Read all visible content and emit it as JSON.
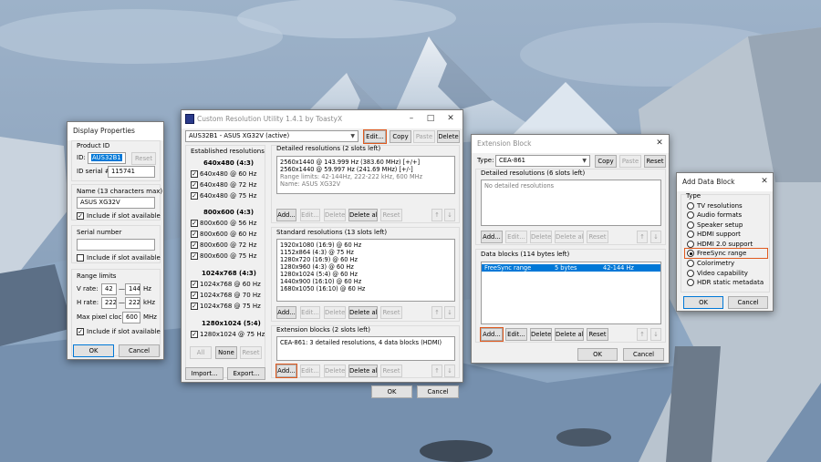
{
  "display_properties": {
    "title": "Display Properties",
    "product_id_label": "Product ID",
    "id_label": "ID:",
    "id_value": "AUS32B1",
    "reset_label": "Reset",
    "serial_label": "ID serial #:",
    "serial_value": "115741",
    "name_label": "Name (13 characters max)",
    "name_value": "ASUS XG32V",
    "include_slot_label": "Include if slot available",
    "serial_number_label": "Serial number",
    "serial_number_value": "",
    "range_limits_label": "Range limits",
    "vrate_label": "V rate:",
    "vrate_min": "42",
    "vrate_max": "144",
    "vrate_unit": "Hz",
    "hrate_label": "H rate:",
    "hrate_min": "222",
    "hrate_max": "222",
    "hrate_unit": "kHz",
    "pixclk_label": "Max pixel clock:",
    "pixclk_value": "600",
    "pixclk_unit": "MHz",
    "dash": "—",
    "ok_label": "OK",
    "cancel_label": "Cancel"
  },
  "cru": {
    "title": "Custom Resolution Utility 1.4.1 by ToastyX",
    "monitor_select": "AUS32B1 - ASUS XG32V (active)",
    "edit_label": "Edit...",
    "copy_label": "Copy",
    "paste_label": "Paste",
    "delete_label": "Delete",
    "established_label": "Established resolutions",
    "est_groups": [
      {
        "header": "640x480 (4:3)",
        "items": [
          "640x480 @ 60 Hz",
          "640x480 @ 72 Hz",
          "640x480 @ 75 Hz"
        ]
      },
      {
        "header": "800x600 (4:3)",
        "items": [
          "800x600 @ 56 Hz",
          "800x600 @ 60 Hz",
          "800x600 @ 72 Hz",
          "800x600 @ 75 Hz"
        ]
      },
      {
        "header": "1024x768 (4:3)",
        "items": [
          "1024x768 @ 60 Hz",
          "1024x768 @ 70 Hz",
          "1024x768 @ 75 Hz"
        ]
      },
      {
        "header": "1280x1024 (5:4)",
        "items": [
          "1280x1024 @ 75 Hz"
        ]
      }
    ],
    "all_label": "All",
    "none_label": "None",
    "reset_label": "Reset",
    "import_label": "Import...",
    "export_label": "Export...",
    "detailed_label": "Detailed resolutions (2 slots left)",
    "detailed_rows": [
      "2560x1440 @ 143.999 Hz (383.60 MHz) [+/+]",
      "2560x1440 @ 59.997 Hz (241.69 MHz) [+/-]"
    ],
    "detailed_gray_rows": [
      "Range limits: 42-144Hz, 222-222 kHz, 600 MHz",
      "Name: ASUS XG32V"
    ],
    "standard_label": "Standard resolutions (13 slots left)",
    "standard_rows": [
      "1920x1080 (16:9) @ 60 Hz",
      "1152x864 (4:3) @ 75 Hz",
      "1280x720 (16:9) @ 60 Hz",
      "1280x960 (4:3) @ 60 Hz",
      "1280x1024 (5:4) @ 60 Hz",
      "1440x900 (16:10) @ 60 Hz",
      "1680x1050 (16:10) @ 60 Hz"
    ],
    "extension_label": "Extension blocks (2 slots left)",
    "extension_rows": [
      "CEA-861: 3 detailed resolutions, 4 data blocks (HDMI)"
    ],
    "add_label": "Add...",
    "edit_small_label": "Edit...",
    "delete_all_label": "Delete all",
    "up_arrow": "↑",
    "down_arrow": "↓",
    "ok_label": "OK",
    "cancel_label": "Cancel"
  },
  "extension_block": {
    "title": "Extension Block",
    "type_label": "Type:",
    "type_value": "CEA-861",
    "copy_label": "Copy",
    "paste_label": "Paste",
    "reset_label": "Reset",
    "detailed_label": "Detailed resolutions (6 slots left)",
    "no_detailed": "No detailed resolutions",
    "add_label": "Add...",
    "edit_label": "Edit...",
    "delete_label": "Delete",
    "delete_all_label": "Delete all",
    "data_blocks_label": "Data blocks (114 bytes left)",
    "data_row": {
      "name": "FreeSync range",
      "size": "5 bytes",
      "range": "42-144 Hz"
    },
    "up_arrow": "↑",
    "down_arrow": "↓",
    "ok_label": "OK",
    "cancel_label": "Cancel"
  },
  "add_data_block": {
    "title": "Add Data Block",
    "type_label": "Type",
    "options": [
      "TV resolutions",
      "Audio formats",
      "Speaker setup",
      "HDMI support",
      "HDMI 2.0 support",
      "FreeSync range",
      "Colorimetry",
      "Video capability",
      "HDR static metadata"
    ],
    "selected_index": 5,
    "ok_label": "OK",
    "cancel_label": "Cancel"
  },
  "colors": {
    "accent": "#0078d7",
    "highlight": "#e05a1f",
    "window_bg": "#f0f0f0"
  }
}
